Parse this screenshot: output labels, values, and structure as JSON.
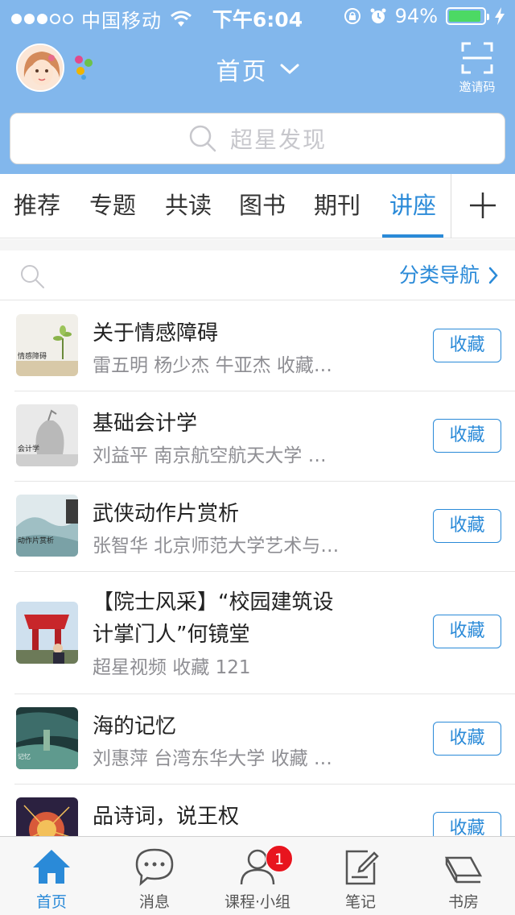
{
  "status_bar": {
    "carrier": "中国移动",
    "time": "下午6:04",
    "battery": "94%",
    "battery_level": 0.94
  },
  "header": {
    "title": "首页",
    "invite_label": "邀请码"
  },
  "search": {
    "placeholder": "超星发现"
  },
  "tabs": [
    {
      "label": "推荐",
      "active": false
    },
    {
      "label": "专题",
      "active": false
    },
    {
      "label": "共读",
      "active": false
    },
    {
      "label": "图书",
      "active": false
    },
    {
      "label": "期刊",
      "active": false
    },
    {
      "label": "讲座",
      "active": true
    }
  ],
  "filter": {
    "category_nav": "分类导航"
  },
  "list": [
    {
      "title": "关于情感障碍",
      "subtitle": "雷五明 杨少杰 牛亚杰   收藏…",
      "button": "收藏",
      "thumb_caption": "情感障碍"
    },
    {
      "title": "基础会计学",
      "subtitle": "刘益平 南京航空航天大学   …",
      "button": "收藏",
      "thumb_caption": "会计学"
    },
    {
      "title": "武侠动作片赏析",
      "subtitle": "张智华 北京师范大学艺术与…",
      "button": "收藏",
      "thumb_caption": "动作片赏析"
    },
    {
      "title": "【院士风采】“校园建筑设",
      "title_line2": "计掌门人”何镜堂",
      "subtitle": "超星视频   收藏 121",
      "button": "收藏"
    },
    {
      "title": "海的记忆",
      "subtitle": "刘惠萍 台湾东华大学   收藏 …",
      "button": "收藏",
      "thumb_caption": "记忆"
    },
    {
      "title": "品诗词，说王权",
      "subtitle": "",
      "button": "收藏"
    }
  ],
  "tabbar": [
    {
      "label": "首页",
      "icon": "home-icon",
      "active": true
    },
    {
      "label": "消息",
      "icon": "chat-bubble-icon",
      "active": false
    },
    {
      "label": "课程·小组",
      "icon": "person-icon",
      "active": false,
      "badge": "1"
    },
    {
      "label": "笔记",
      "icon": "note-edit-icon",
      "active": false
    },
    {
      "label": "书房",
      "icon": "bookshelf-icon",
      "active": false
    }
  ],
  "colors": {
    "header_bg": "#82b7ec",
    "accent": "#2a8ad8",
    "badge": "#e8141e",
    "battery": "#4cd964"
  }
}
